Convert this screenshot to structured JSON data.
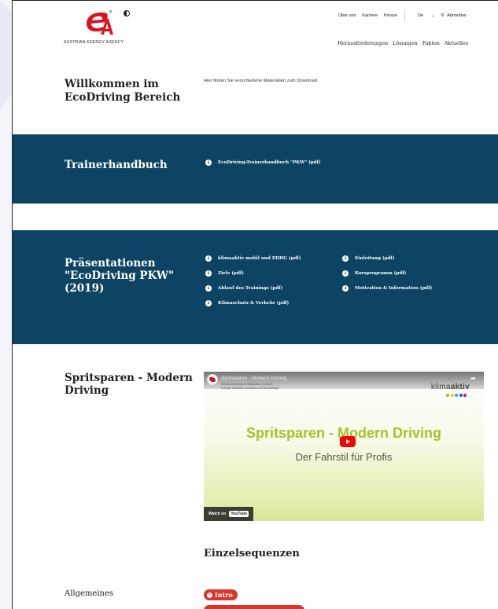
{
  "header": {
    "logo_text": "AUSTRIAN ENERGY AGENCY",
    "logo_registered": "®",
    "top_nav": [
      "Über uns",
      "Karriere",
      "Presse"
    ],
    "language": "De",
    "language_chevron": "⌄",
    "search_icon_glyph": "⚲",
    "logout": "Abmelden",
    "main_nav": [
      "Herausforderungen",
      "Lösungen",
      "Fakten",
      "Aktuelles"
    ]
  },
  "welcome": {
    "title": "Willkommen im EcoDriving Bereich",
    "text": "Hier finden Sie verschiedene Materialien zum Download"
  },
  "trainer": {
    "title": "Trainerhandbuch",
    "download": "EcoDriving-Trainerhandbuch \"PKW\" (pdf)"
  },
  "presentations": {
    "title": "Präsentationen \"EcoDriving PKW\" (2019)",
    "left": [
      "klimaaktiv mobil und EDHG (pdf)",
      "Ziele (pdf)",
      "Ablauf des Trainings (pdf)",
      "Klimaschutz & Verkehr (pdf)"
    ],
    "right": [
      "Einleitung (pdf)",
      "Kursprogramm (pdf)",
      "Motivation & Information (pdf)"
    ]
  },
  "video_section": {
    "title": "Spritsparen - Modern Driving",
    "video": {
      "top_title": "Spritsparen - Modern Driving",
      "ministry": "Bundesministerium Klimaschutz, Umwelt, Energie, Mobilität, Innovation und Technologie",
      "brand_prefix": "klima",
      "brand_suffix": "aktiv",
      "headline": "Spritsparen - Modern Driving",
      "subheadline": "Der Fahrstil für Profis",
      "watch_on": "Watch on",
      "youtube": "YouTube",
      "dot_colors": [
        "#a7c22a",
        "#f5c400",
        "#3da0d8",
        "#1a5fa8",
        "#e6007e"
      ]
    }
  },
  "sequences": {
    "title": "Einzelsequenzen",
    "category": "Allgemeines",
    "first_button": "Intro"
  },
  "colors": {
    "band": "#0d4464",
    "accent_red": "#d9352a"
  }
}
